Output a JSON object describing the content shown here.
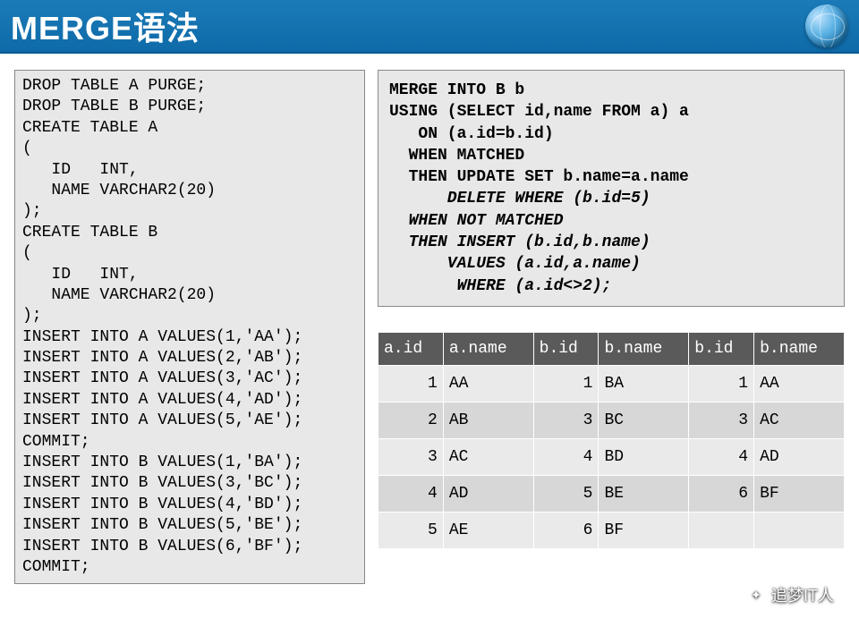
{
  "header": {
    "title": "MERGE语法"
  },
  "code_left": "DROP TABLE A PURGE;\nDROP TABLE B PURGE;\nCREATE TABLE A\n(\n   ID   INT,\n   NAME VARCHAR2(20)\n);\nCREATE TABLE B\n(\n   ID   INT,\n   NAME VARCHAR2(20)\n);\nINSERT INTO A VALUES(1,'AA');\nINSERT INTO A VALUES(2,'AB');\nINSERT INTO A VALUES(3,'AC');\nINSERT INTO A VALUES(4,'AD');\nINSERT INTO A VALUES(5,'AE');\nCOMMIT;\nINSERT INTO B VALUES(1,'BA');\nINSERT INTO B VALUES(3,'BC');\nINSERT INTO B VALUES(4,'BD');\nINSERT INTO B VALUES(5,'BE');\nINSERT INTO B VALUES(6,'BF');\nCOMMIT;",
  "merge": {
    "l1": "MERGE INTO B b",
    "l2": "USING (SELECT id,name FROM a) a",
    "l3": "   ON (a.id=b.id)",
    "l4": "  WHEN MATCHED",
    "l5": "  THEN UPDATE SET b.name=a.name",
    "l6": "      DELETE WHERE (b.id=5)",
    "l7": "  WHEN NOT MATCHED",
    "l8": "  THEN INSERT (b.id,b.name)",
    "l9": "      VALUES (a.id,a.name)",
    "l10": "       WHERE (a.id<>2);"
  },
  "table": {
    "headers": [
      "a.id",
      "a.name",
      "b.id",
      "b.name",
      "b.id",
      "b.name"
    ],
    "rows": [
      [
        "1",
        "AA",
        "1",
        "BA",
        "1",
        "AA"
      ],
      [
        "2",
        "AB",
        "3",
        "BC",
        "3",
        "AC"
      ],
      [
        "3",
        "AC",
        "4",
        "BD",
        "4",
        "AD"
      ],
      [
        "4",
        "AD",
        "5",
        "BE",
        "6",
        "BF"
      ],
      [
        "5",
        "AE",
        "6",
        "BF",
        "",
        ""
      ]
    ]
  },
  "watermark": {
    "text": "追梦IT人"
  }
}
